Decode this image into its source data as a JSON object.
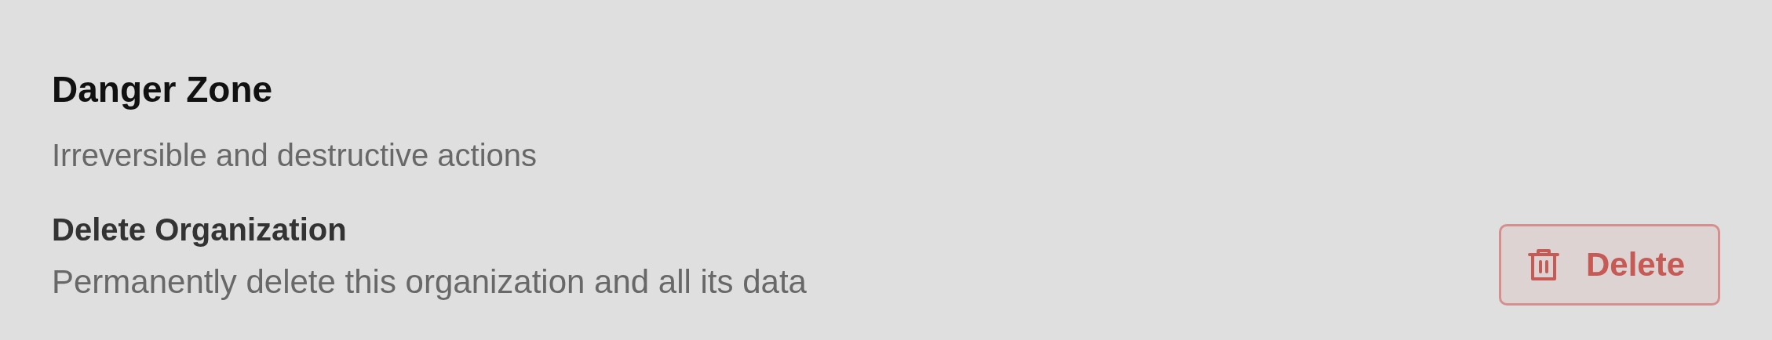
{
  "section": {
    "title": "Danger Zone",
    "subtitle": "Irreversible and destructive actions"
  },
  "action": {
    "title": "Delete Organization",
    "description": "Permanently delete this organization and all its data",
    "button": "Delete"
  }
}
